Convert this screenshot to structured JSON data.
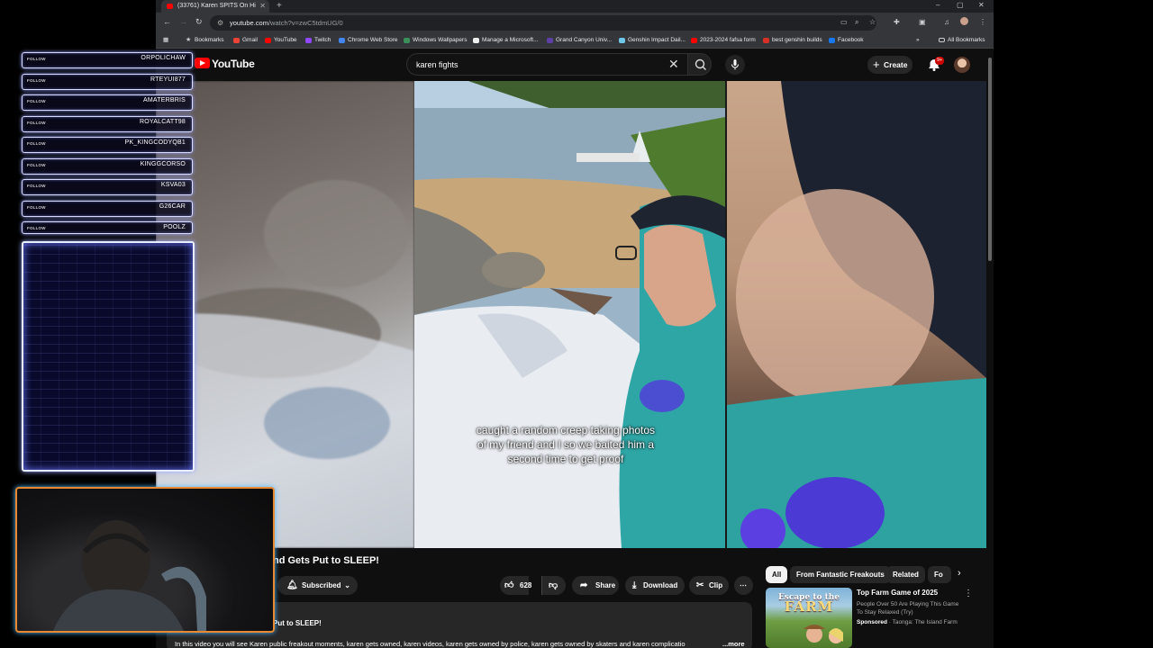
{
  "browser": {
    "tab_title": "(33761) Karen SPITS On Hi",
    "url_host": "youtube.com",
    "url_path": "/watch?v=zwC5tdmUG/0",
    "bookmarks": [
      "Bookmarks",
      "Gmail",
      "YouTube",
      "Twitch",
      "Chrome Web Store",
      "Windows Wallpapers",
      "Manage a Microsoft...",
      "Grand Canyon Univ...",
      "Genshin Impact Dail...",
      "2023-2024 fafsa form",
      "best genshin builds",
      "Facebook"
    ],
    "all_bookmarks": "All Bookmarks"
  },
  "youtube": {
    "logo_text": "YouTube",
    "search_query": "karen fights",
    "create_label": "Create",
    "notification_count": "9+"
  },
  "video": {
    "caption": "caught a random creep taking photos of my friend and I so we baited him a second time to get proof",
    "title_visible": "nd Gets Put to SLEEP!",
    "subscribed_label": "Subscribed",
    "like_count": "628",
    "share_label": "Share",
    "download_label": "Download",
    "clip_label": "Clip",
    "description_title": "Put to SLEEP!",
    "description_text": "In this video you will see Karen public freakout moments, karen gets owned, karen videos, karen gets owned by police, karen gets owned by skaters and karen complicatio",
    "more_label": "...more"
  },
  "sidebar": {
    "chips": [
      "All",
      "From Fantastic Freakouts",
      "Related",
      "Fo"
    ],
    "recommendation": {
      "thumb_line1": "Escape to the",
      "thumb_line2": "FARM",
      "title": "Top Farm Game of 2025",
      "description": "People Over 50 Are Playing This Game To Stay Relaxed (Try)",
      "sponsored": "Sponsored",
      "channel": "· Taonga: The Island Farm"
    }
  },
  "stream_overlay": {
    "follow_label": "FOLLOW",
    "followers": [
      "ORPOLICHAW",
      "RTEYUI877",
      "AMATERBRIS",
      "ROYALCATT98",
      "PK_KINGCODYQB1",
      "KINGGCORSO",
      "KSVA03",
      "G26CAR",
      "POOLZ"
    ]
  }
}
